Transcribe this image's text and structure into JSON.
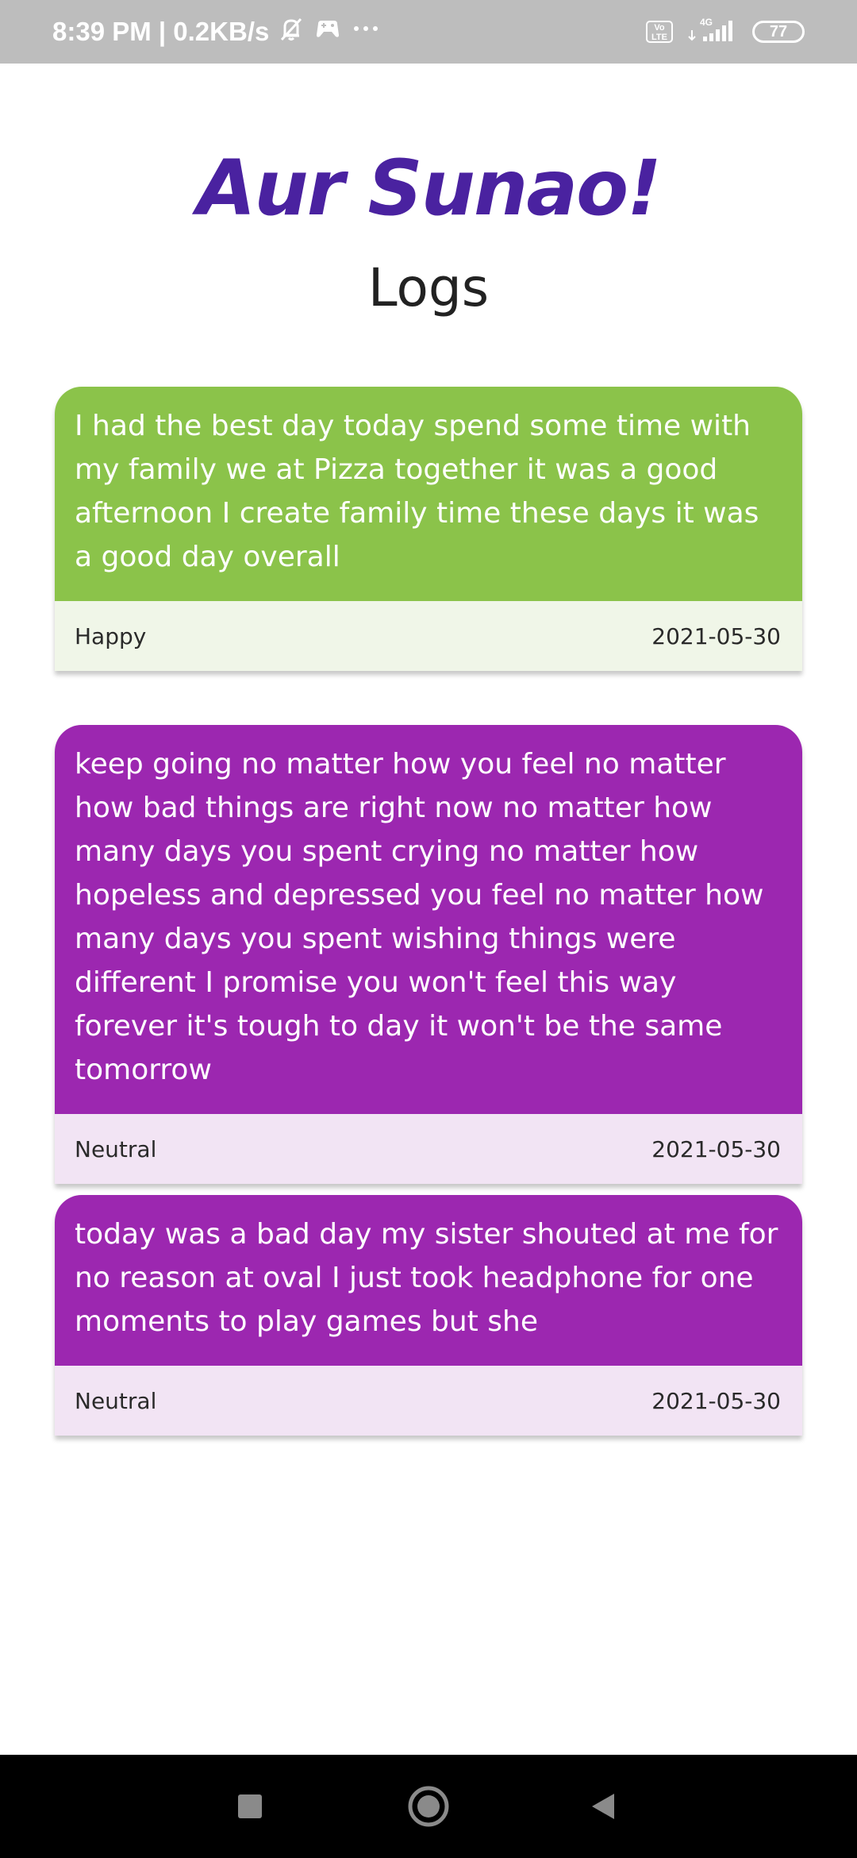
{
  "status_bar": {
    "time_speed": "8:39 PM | 0.2KB/s",
    "volte_label": "Vo LTE",
    "network_label": "4G",
    "battery": "77",
    "icons": [
      "mute-icon",
      "game-icon",
      "more-icon",
      "volte-icon",
      "signal-icon",
      "battery-icon"
    ]
  },
  "app": {
    "title": "Aur Sunao!",
    "page_title": "Logs",
    "title_color": "#4a22a0"
  },
  "logs": [
    {
      "text": "I had the best day today spend some time with my family we at Pizza together it was a good afternoon I create family time these days it was a good day overall",
      "mood": "Happy",
      "date": "2021-05-30",
      "color": "#8bc34a"
    },
    {
      "text": "keep going no matter how you feel no matter how bad things are right now no matter how many days you spent crying no matter how hopeless and depressed you feel no matter how many days you spent wishing things were different I promise you won't feel this way forever it's tough to day it won't be the same tomorrow",
      "mood": "Neutral",
      "date": "2021-05-30",
      "color": "#9c27b0"
    },
    {
      "text": "today was a bad day my sister shouted at me for no reason at oval I just took headphone for one moments to play games but she",
      "mood": "Neutral",
      "date": "2021-05-30",
      "color": "#9c27b0"
    }
  ],
  "nav_bar": {
    "buttons": [
      "recents-icon",
      "home-icon",
      "back-icon"
    ]
  }
}
